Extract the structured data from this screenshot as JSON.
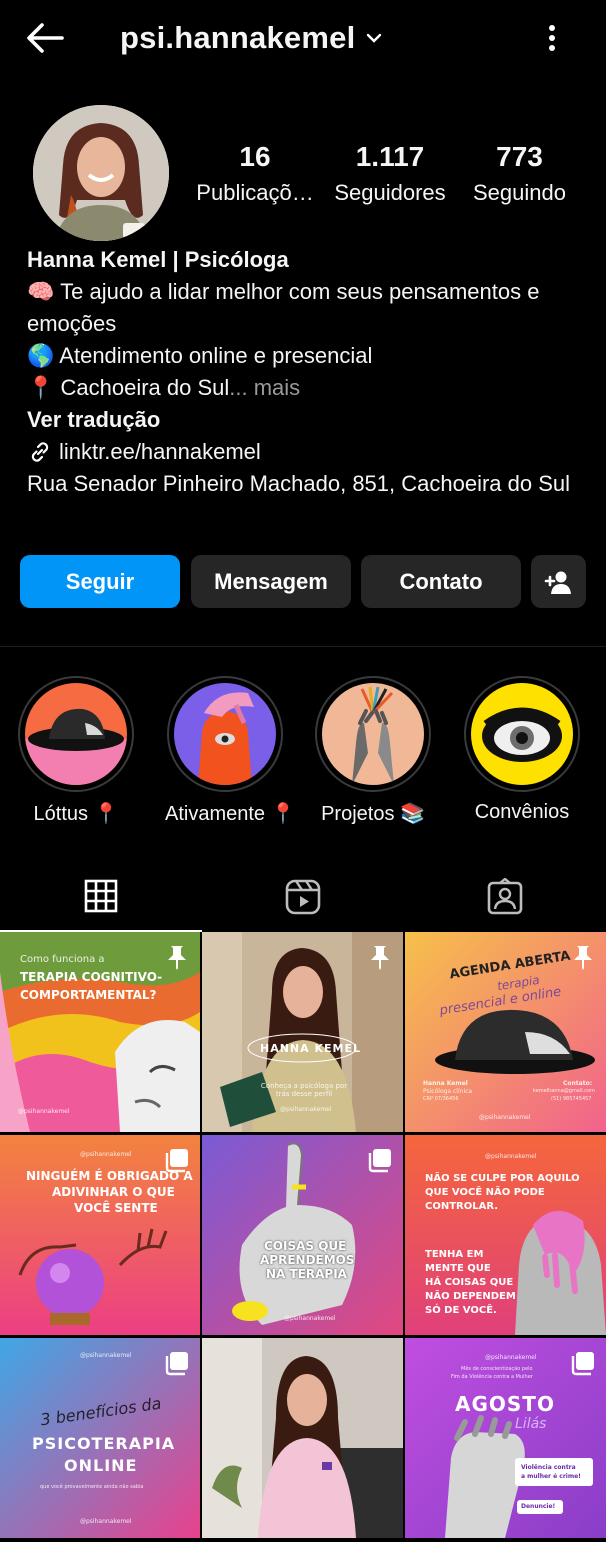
{
  "topbar": {
    "username": "psi.hannakemel"
  },
  "stats": [
    {
      "value": "16",
      "label": "Publicaçõ…"
    },
    {
      "value": "1.117",
      "label": "Seguidores"
    },
    {
      "value": "773",
      "label": "Seguindo"
    }
  ],
  "bio": {
    "name": "Hanna Kemel | Psicóloga",
    "line1": "🧠 Te ajudo a lidar melhor com seus pensamentos e emoções",
    "line2": "🌎 Atendimento online e presencial",
    "line3": "📍 Cachoeira do Sul",
    "more": "... mais",
    "translate": "Ver tradução",
    "link": "linktr.ee/hannakemel",
    "address": "Rua Senador Pinheiro Machado, 851, Cachoeira do Sul"
  },
  "actions": {
    "follow": "Seguir",
    "message": "Mensagem",
    "contact": "Contato"
  },
  "highlights": [
    {
      "label": "Lóttus 📍"
    },
    {
      "label": "Ativamente 📍"
    },
    {
      "label": "Projetos 📚"
    },
    {
      "label": "Convênios"
    }
  ],
  "posts": [
    {
      "line1": "Como funciona a",
      "line2": "TERAPIA COGNITIVO-",
      "line3": "COMPORTAMENTAL?",
      "handle": "@psihannakemel"
    },
    {
      "title": "HANNA KEMEL",
      "sub": "Conheça a psicóloga por trás desse perfil",
      "handle": "@psihannakemel"
    },
    {
      "line1": "AGENDA ABERTA",
      "line2": "terapia",
      "line3": "presencial e online",
      "foot1": "Hanna Kemel",
      "foot2": "Psicóloga clínica",
      "foot3": "CRP 07/36456",
      "contact": "Contato:",
      "email": "kemelhanna@gmail.com",
      "phone": "(51) 985745457",
      "handle": "@psihannakemel"
    },
    {
      "handle": "@psihannakemel",
      "line1": "NINGUÉM É OBRIGADO A",
      "line2": "ADIVINHAR O QUE",
      "line3": "VOCÊ SENTE"
    },
    {
      "line1": "COISAS QUE",
      "line2": "APRENDEMOS",
      "line3": "NA TERAPIA",
      "handle": "@psihannakemel"
    },
    {
      "handle": "@psihannakemel",
      "line1": "NÃO SE CULPE POR AQUILO",
      "line2": "QUE VOCÊ NÃO PODE",
      "line3": "CONTROLAR.",
      "line4": "TENHA EM",
      "line5": "MENTE QUE",
      "line6": "HÁ COISAS QUE",
      "line7": "NÃO DEPENDEM",
      "line8": "SÓ DE VOCÊ."
    },
    {
      "handle": "@psihannakemel",
      "line1": "3 benefícios da",
      "line2": "PSICOTERAPIA",
      "line3": "ONLINE",
      "sub": "que você provavelmente ainda não sabia",
      "handle2": "@psihannakemel"
    },
    {},
    {
      "handle": "@psihannakemel",
      "sub1": "Mês de conscientização pelo",
      "sub2": "Fim da Violência contra a Mulher",
      "line1": "AGOSTO",
      "line2": "Lilás",
      "tag1": "Violência contra",
      "tag2": "a mulher é crime!",
      "tag3": "Denuncie!"
    }
  ],
  "colors": {
    "accent": "#0095f6",
    "button_bg": "#262626",
    "background": "#000000"
  }
}
